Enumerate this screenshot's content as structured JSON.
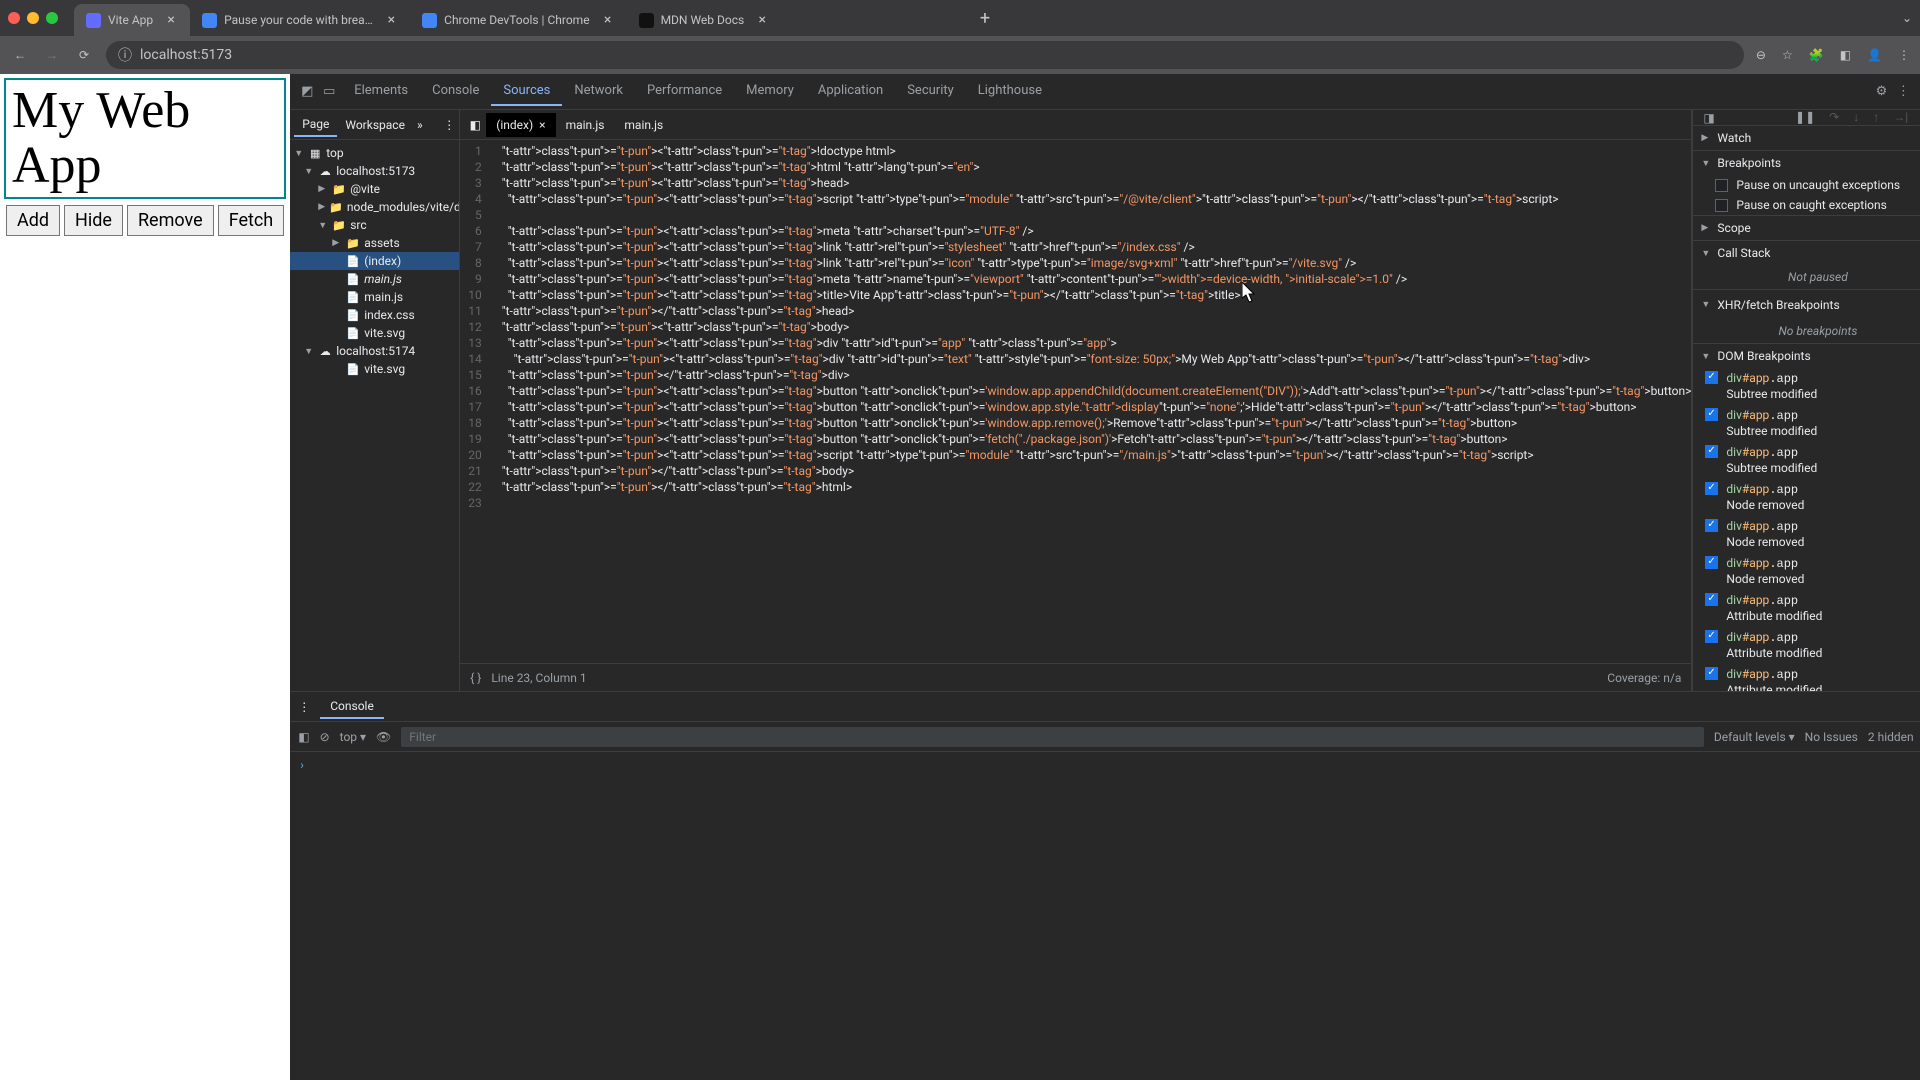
{
  "chrome": {
    "tabs": [
      {
        "title": "Vite App",
        "icon": "#646cff"
      },
      {
        "title": "Pause your code with breakp",
        "icon": "#4285f4"
      },
      {
        "title": "Chrome DevTools | Chrome",
        "icon": "#4285f4"
      },
      {
        "title": "MDN Web Docs",
        "icon": "#111"
      }
    ],
    "url": "localhost:5173"
  },
  "page": {
    "heading": "My Web App",
    "buttons": [
      "Add",
      "Hide",
      "Remove",
      "Fetch"
    ]
  },
  "devtools": {
    "panels": [
      "Elements",
      "Console",
      "Sources",
      "Network",
      "Performance",
      "Memory",
      "Application",
      "Security",
      "Lighthouse"
    ],
    "active": "Sources"
  },
  "navigator": {
    "tabs": [
      "Page",
      "Workspace"
    ],
    "tree": [
      {
        "d": 0,
        "tri": "▼",
        "ico": "▦",
        "txt": "top"
      },
      {
        "d": 1,
        "tri": "▼",
        "ico": "☁",
        "txt": "localhost:5173"
      },
      {
        "d": 2,
        "tri": "▶",
        "ico": "📁",
        "txt": "@vite"
      },
      {
        "d": 2,
        "tri": "▶",
        "ico": "📁",
        "txt": "node_modules/vite/dis"
      },
      {
        "d": 2,
        "tri": "▼",
        "ico": "📁",
        "txt": "src"
      },
      {
        "d": 3,
        "tri": "▶",
        "ico": "📁",
        "txt": "assets"
      },
      {
        "d": 3,
        "tri": "",
        "ico": "📄",
        "txt": "(index)",
        "sel": true
      },
      {
        "d": 3,
        "tri": "",
        "ico": "📄",
        "txt": "main.js",
        "it": true
      },
      {
        "d": 3,
        "tri": "",
        "ico": "📄",
        "txt": "main.js"
      },
      {
        "d": 3,
        "tri": "",
        "ico": "📄",
        "txt": "index.css"
      },
      {
        "d": 3,
        "tri": "",
        "ico": "📄",
        "txt": "vite.svg"
      },
      {
        "d": 1,
        "tri": "▼",
        "ico": "☁",
        "txt": "localhost:5174"
      },
      {
        "d": 3,
        "tri": "",
        "ico": "📄",
        "txt": "vite.svg"
      }
    ]
  },
  "openFiles": [
    "(index)",
    "main.js",
    "main.js"
  ],
  "code": {
    "lines": [
      "<!doctype html>",
      "<html lang=\"en\">",
      "<head>",
      "  <script type=\"module\" src=\"/@vite/client\"></script>",
      "",
      "  <meta charset=\"UTF-8\" />",
      "  <link rel=\"stylesheet\" href=\"/index.css\" />",
      "  <link rel=\"icon\" type=\"image/svg+xml\" href=\"/vite.svg\" />",
      "  <meta name=\"viewport\" content=\"width=device-width, initial-scale=1.0\" />",
      "  <title>Vite App</title>",
      "</head>",
      "<body>",
      "  <div id=\"app\" class=\"app\">",
      "    <div id=\"text\" style=\"font-size: 50px;\">My Web App</div>",
      "  </div>",
      "  <button onclick='window.app.appendChild(document.createElement(\"DIV\"));'>Add</button>",
      "  <button onclick='window.app.style.display=\"none\";'>Hide</button>",
      "  <button onclick='window.app.remove();'>Remove</button>",
      "  <button onclick='fetch(\"./package.json\")'>Fetch</button>",
      "  <script type=\"module\" src=\"/main.js\"></script>",
      "</body>",
      "</html>",
      ""
    ],
    "status": "Line 23, Column 1",
    "coverage": "Coverage: n/a"
  },
  "debugger": {
    "watch": "Watch",
    "breakpoints": "Breakpoints",
    "pauseUncaught": "Pause on uncaught exceptions",
    "pauseCaught": "Pause on caught exceptions",
    "scope": "Scope",
    "callstack": "Call Stack",
    "notPaused": "Not paused",
    "xhr": "XHR/fetch Breakpoints",
    "noBp": "No breakpoints",
    "dom": "DOM Breakpoints",
    "domItems": [
      {
        "sel": "div#app.app",
        "type": "Subtree modified"
      },
      {
        "sel": "div#app.app",
        "type": "Subtree modified"
      },
      {
        "sel": "div#app.app",
        "type": "Subtree modified"
      },
      {
        "sel": "div#app.app",
        "type": "Node removed"
      },
      {
        "sel": "div#app.app",
        "type": "Node removed"
      },
      {
        "sel": "div#app.app",
        "type": "Node removed"
      },
      {
        "sel": "div#app.app",
        "type": "Attribute modified"
      },
      {
        "sel": "div#app.app",
        "type": "Attribute modified"
      },
      {
        "sel": "div#app.app",
        "type": "Attribute modified"
      }
    ]
  },
  "console": {
    "tab": "Console",
    "context": "top",
    "filter": "Filter",
    "levels": "Default levels",
    "issues": "No Issues",
    "hidden": "2 hidden"
  }
}
